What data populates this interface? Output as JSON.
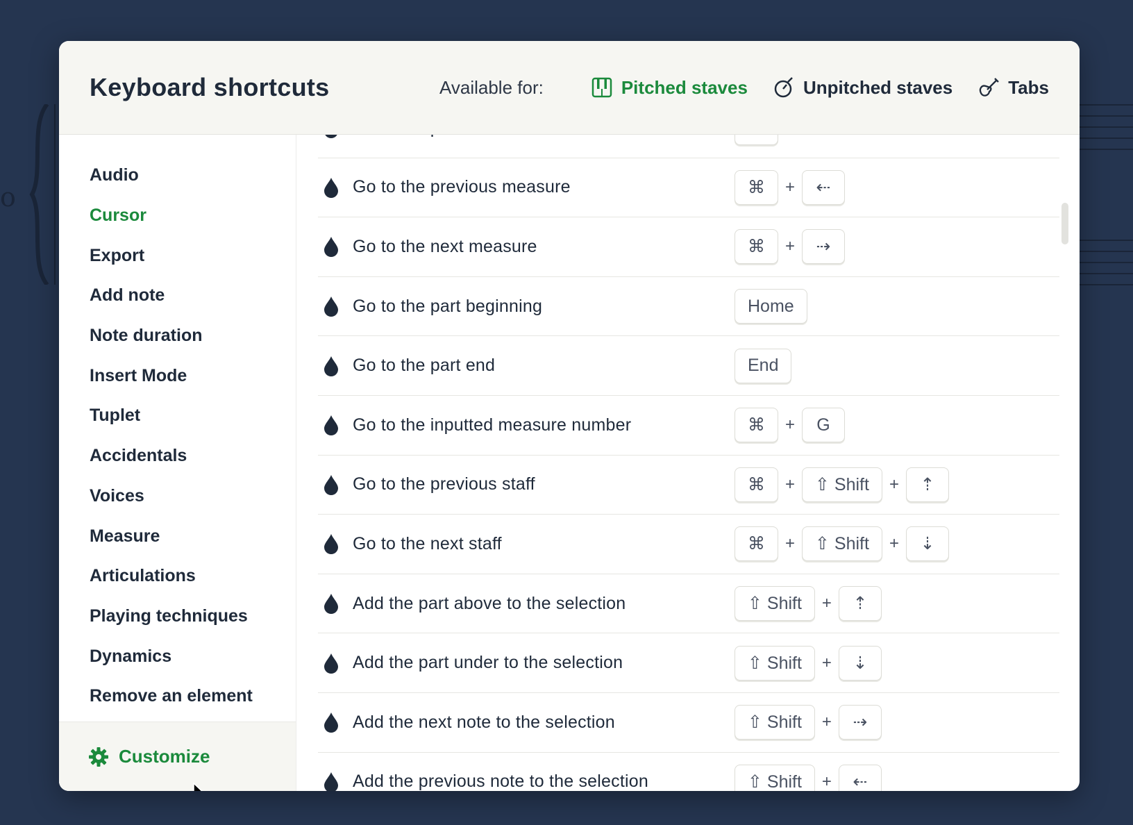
{
  "header": {
    "title": "Keyboard shortcuts",
    "available_label": "Available for:",
    "filters": [
      {
        "label": "Pitched staves",
        "icon": "piano-keys-icon",
        "active": true
      },
      {
        "label": "Unpitched staves",
        "icon": "drum-icon",
        "active": false
      },
      {
        "label": "Tabs",
        "icon": "guitar-icon",
        "active": false
      }
    ]
  },
  "sidebar": {
    "items": [
      {
        "label": "Audio",
        "active": false
      },
      {
        "label": "Cursor",
        "active": true
      },
      {
        "label": "Export",
        "active": false
      },
      {
        "label": "Add note",
        "active": false
      },
      {
        "label": "Note duration",
        "active": false
      },
      {
        "label": "Insert Mode",
        "active": false
      },
      {
        "label": "Tuplet",
        "active": false
      },
      {
        "label": "Accidentals",
        "active": false
      },
      {
        "label": "Voices",
        "active": false
      },
      {
        "label": "Measure",
        "active": false
      },
      {
        "label": "Articulations",
        "active": false
      },
      {
        "label": "Playing techniques",
        "active": false
      },
      {
        "label": "Dynamics",
        "active": false
      },
      {
        "label": "Remove an element",
        "active": false
      }
    ],
    "customize_label": "Customize"
  },
  "shortcuts": [
    {
      "label": "Go to the previous note",
      "keys": [
        "←"
      ]
    },
    {
      "label": "Go to the previous measure",
      "keys": [
        "⌘",
        "⇠"
      ]
    },
    {
      "label": "Go to the next measure",
      "keys": [
        "⌘",
        "⇢"
      ]
    },
    {
      "label": "Go to the part beginning",
      "keys": [
        "Home"
      ]
    },
    {
      "label": "Go to the part end",
      "keys": [
        "End"
      ]
    },
    {
      "label": "Go to the inputted measure number",
      "keys": [
        "⌘",
        "G"
      ]
    },
    {
      "label": "Go to the previous staff",
      "keys": [
        "⌘",
        "⇧ Shift",
        "⇡"
      ]
    },
    {
      "label": "Go to the next staff",
      "keys": [
        "⌘",
        "⇧ Shift",
        "⇣"
      ]
    },
    {
      "label": "Add the part above to the selection",
      "keys": [
        "⇧ Shift",
        "⇡"
      ]
    },
    {
      "label": "Add the part under to the selection",
      "keys": [
        "⇧ Shift",
        "⇣"
      ]
    },
    {
      "label": "Add the next note to the selection",
      "keys": [
        "⇧ Shift",
        "⇢"
      ]
    },
    {
      "label": "Add the previous note to the selection",
      "keys": [
        "⇧ Shift",
        "⇠"
      ]
    }
  ],
  "key_separator": "+",
  "colors": {
    "accent": "#1b8a3c",
    "text": "#1f2a3a",
    "background": "#253550"
  }
}
